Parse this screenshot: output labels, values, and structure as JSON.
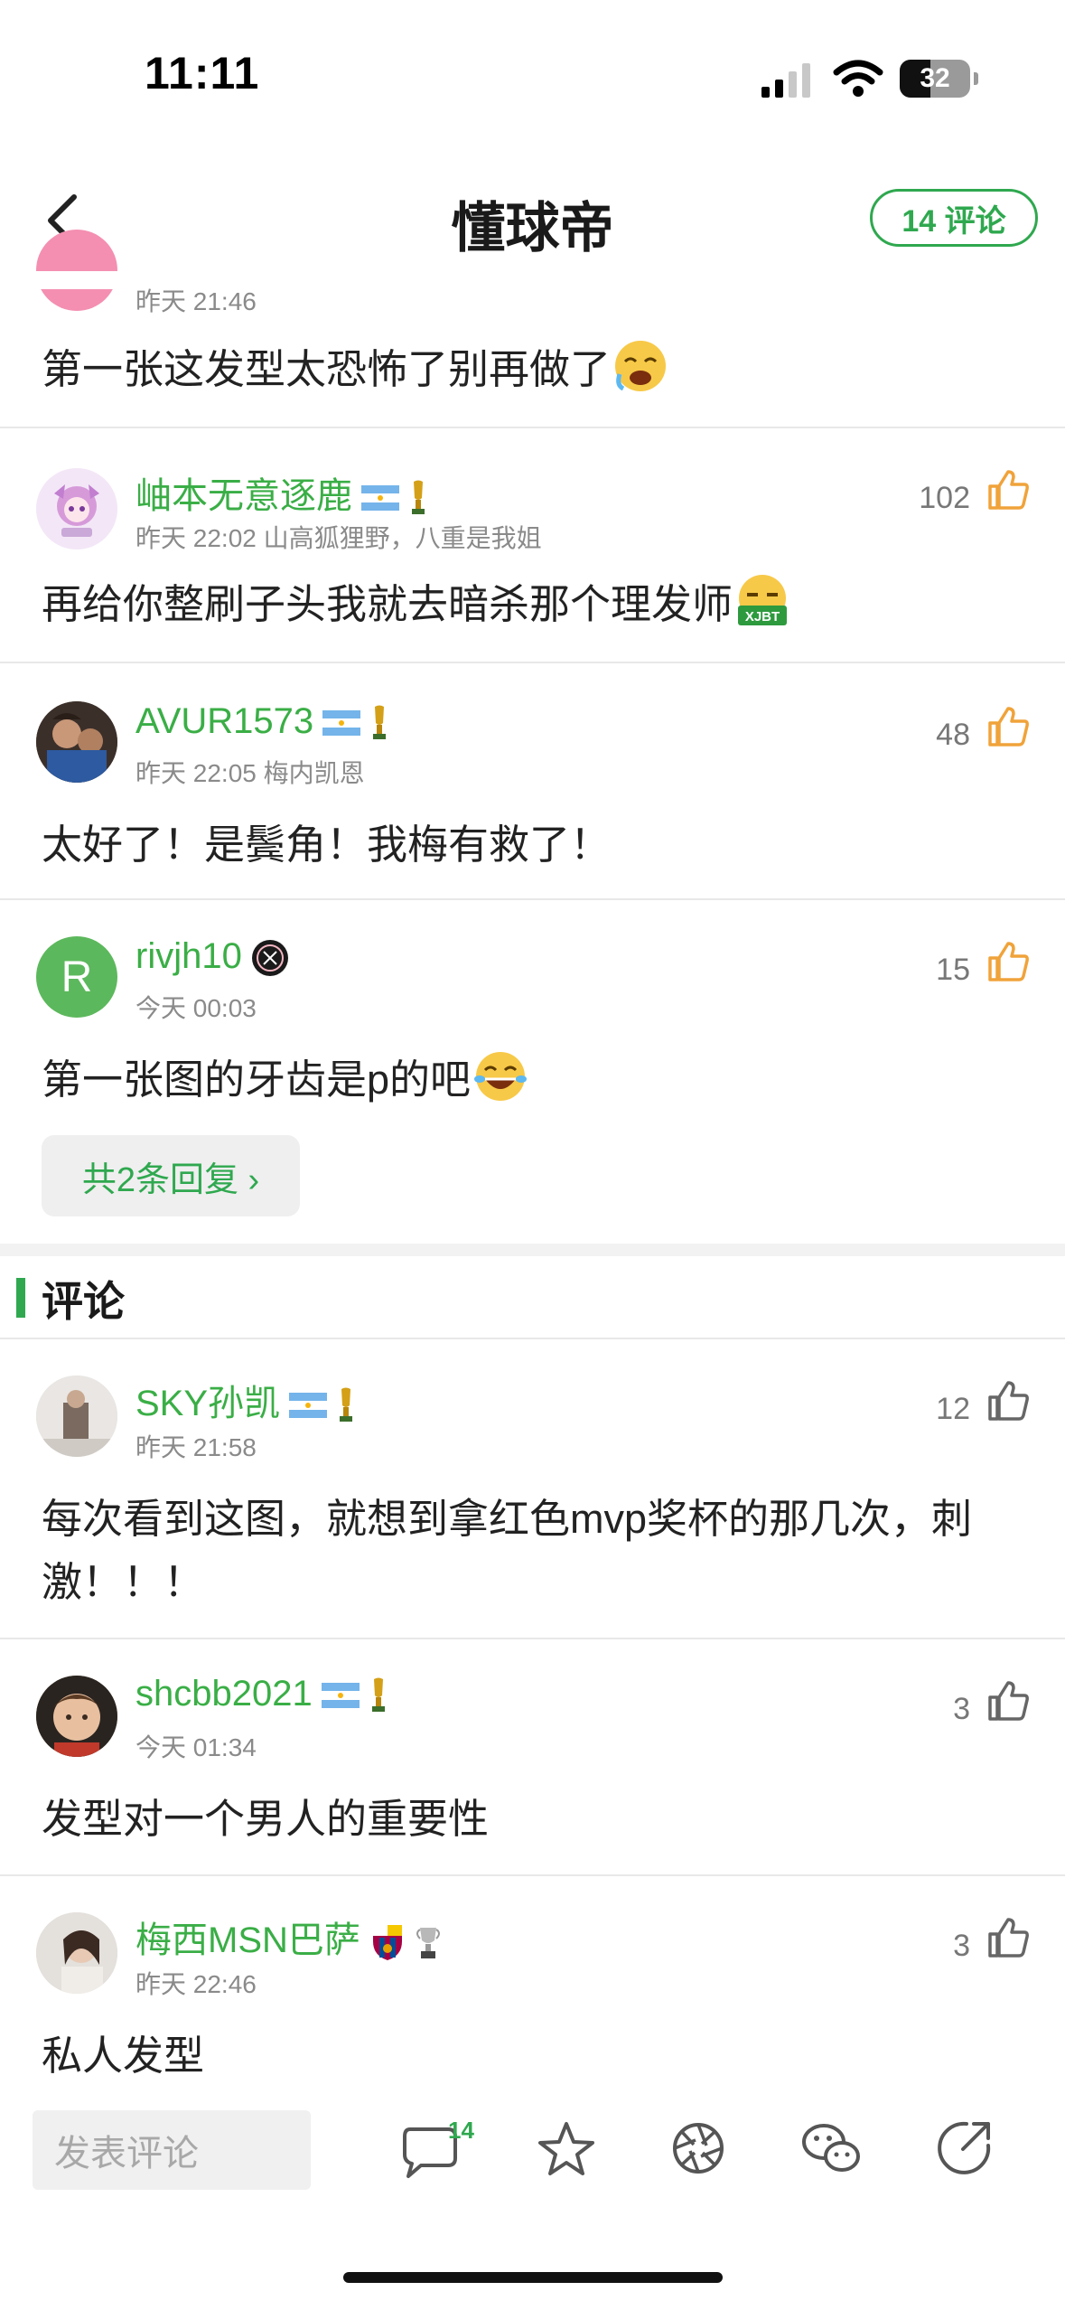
{
  "status_bar": {
    "time": "11:11",
    "battery": "32"
  },
  "nav": {
    "title": "懂球帝",
    "comment_button": "14 评论"
  },
  "comments_top": [
    {
      "time": "昨天 21:46",
      "text": "第一张这发型太恐怖了别再做了"
    },
    {
      "username": "岫本无意逐鹿",
      "meta": "昨天 22:02 山高狐狸野，八重是我姐",
      "likes": "102",
      "text": "再给你整刷子头我就去暗杀那个理发师",
      "emoji_text": "XJBT"
    },
    {
      "username": "AVUR1573",
      "meta": "昨天 22:05 梅内凯恩",
      "likes": "48",
      "text": "太好了！是鬓角！我梅有救了！"
    },
    {
      "username": "rivjh10",
      "avatar_letter": "R",
      "meta": "今天 00:03",
      "likes": "15",
      "text": "第一张图的牙齿是p的吧",
      "reply_label": "共2条回复 ›"
    }
  ],
  "section": {
    "title": "评论"
  },
  "comments_main": [
    {
      "username": "SKY孙凯",
      "meta": "昨天 21:58",
      "likes": "12",
      "text": "每次看到这图，就想到拿红色mvp奖杯的那几次，刺激！！！"
    },
    {
      "username": "shcbb2021",
      "meta": "今天 01:34",
      "likes": "3",
      "text": "发型对一个男人的重要性"
    },
    {
      "username": "梅西MSN巴萨",
      "meta": "昨天 22:46",
      "likes": "3",
      "text": "私人发型"
    }
  ],
  "bottom_bar": {
    "input_placeholder": "发表评论",
    "comment_badge": "14"
  },
  "colors": {
    "accent_green": "#2fa84f",
    "username_green": "#3aae46",
    "like_orange": "#f0a33a",
    "like_gray": "#666666"
  },
  "icons": [
    "back-chevron-icon",
    "signal-icon",
    "wifi-icon",
    "battery-icon",
    "thumbs-up-icon",
    "comment-bubble-icon",
    "star-icon",
    "aperture-icon",
    "wechat-icon",
    "share-icon"
  ]
}
